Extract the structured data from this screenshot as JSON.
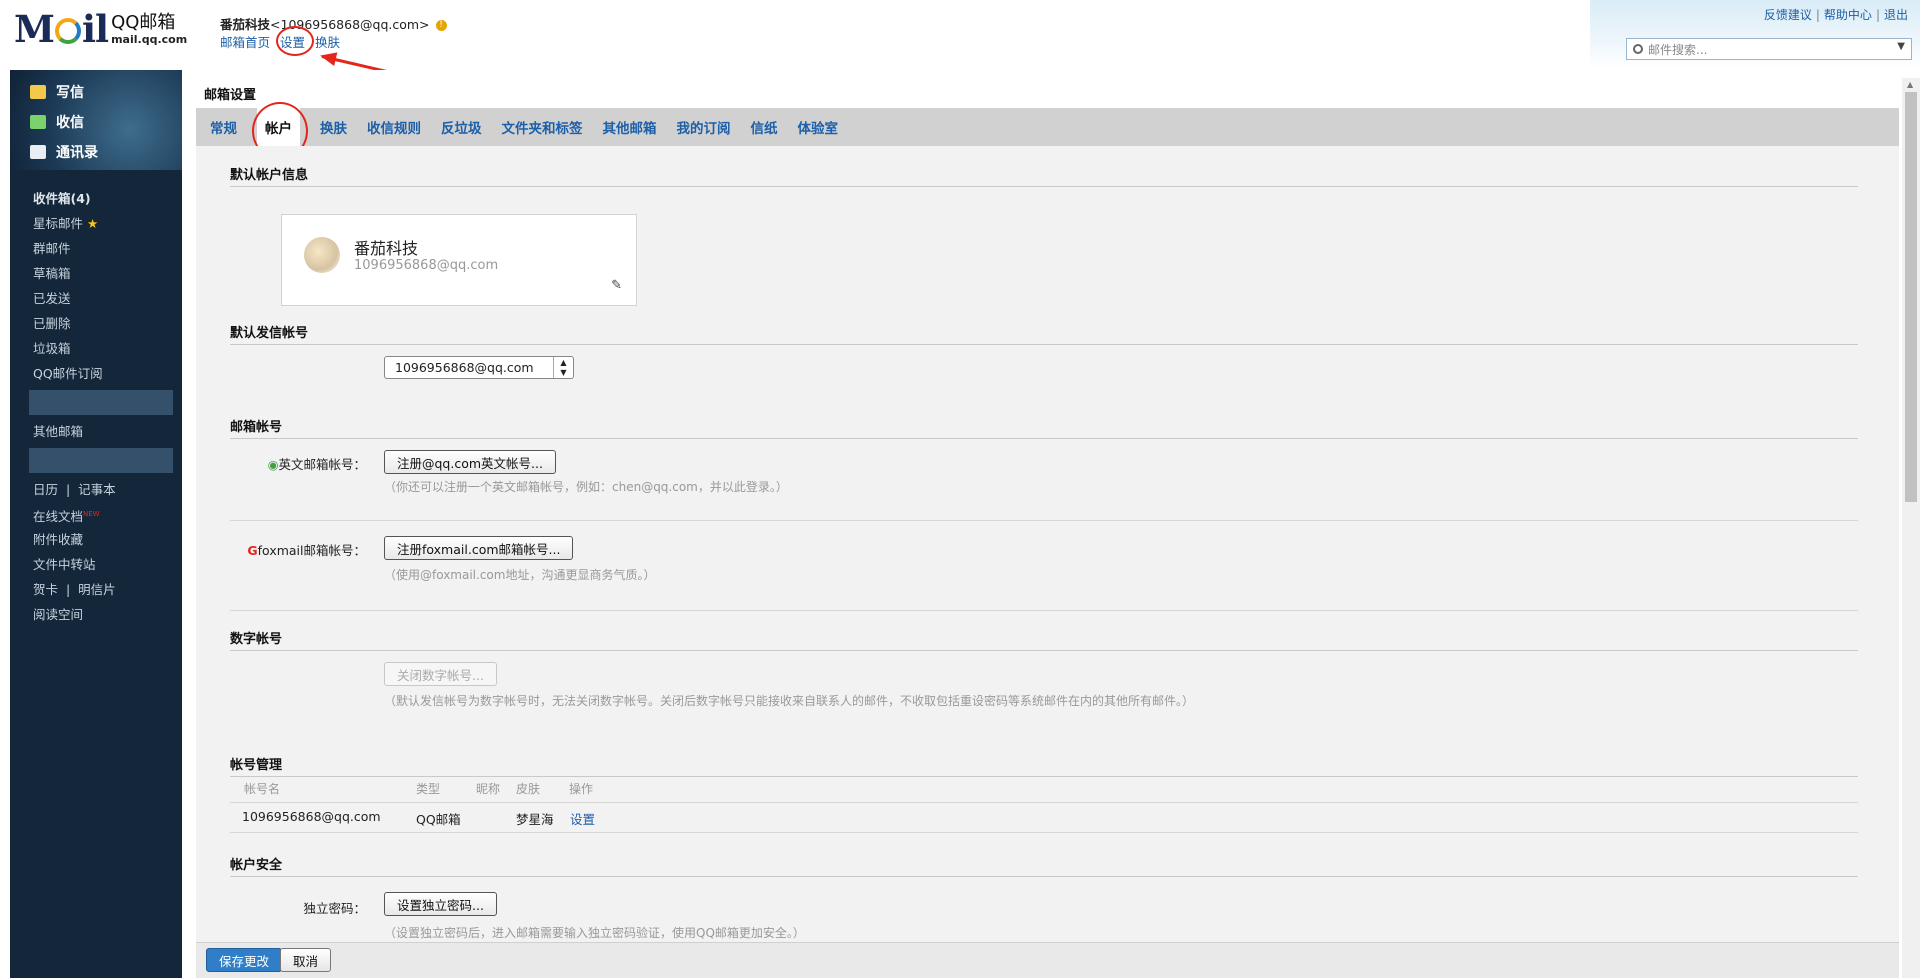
{
  "header": {
    "logo_mark": "MOIL",
    "logo_title": "QQ邮箱",
    "logo_domain": "mail.qq.com",
    "user_name": "番茄科技",
    "user_email": "<1096956868@qq.com>",
    "top_links": [
      "邮箱首页",
      "设置",
      "换肤"
    ],
    "right_links": [
      "反馈建议",
      "帮助中心",
      "退出"
    ],
    "search_placeholder": "邮件搜索..."
  },
  "sidebar": {
    "nav": [
      {
        "label": "写信",
        "icon": "compose-icon"
      },
      {
        "label": "收信",
        "icon": "inbox-download-icon"
      },
      {
        "label": "通讯录",
        "icon": "contacts-icon"
      }
    ],
    "folders": [
      "收件箱(4)",
      "星标邮件",
      "群邮件",
      "草稿箱",
      "已发送",
      "已删除",
      "垃圾箱",
      "QQ邮件订阅"
    ],
    "other": "其他邮箱",
    "tools": [
      "日历",
      "记事本",
      "在线文档",
      "NEW",
      "附件收藏",
      "文件中转站",
      "贺卡",
      "明信片",
      "阅读空间"
    ]
  },
  "page_title": "邮箱设置",
  "tabs": [
    "常规",
    "帐户",
    "换肤",
    "收信规则",
    "反垃圾",
    "文件夹和标签",
    "其他邮箱",
    "我的订阅",
    "信纸",
    "体验室"
  ],
  "active_tab": "帐户",
  "default_account": {
    "section": "默认帐户信息",
    "name": "番茄科技",
    "email": "1096956868@qq.com"
  },
  "default_sender": {
    "section": "默认发信帐号",
    "value": "1096956868@qq.com"
  },
  "mail_accounts": {
    "section": "邮箱帐号",
    "english_label": "英文邮箱帐号：",
    "english_button": "注册@qq.com英文帐号...",
    "english_hint": "（你还可以注册一个英文邮箱帐号，例如：chen@qq.com，并以此登录。）",
    "foxmail_label": "foxmail邮箱帐号：",
    "foxmail_button": "注册foxmail.com邮箱帐号...",
    "foxmail_hint": "（使用@foxmail.com地址，沟通更显商务气质。）"
  },
  "digital_account": {
    "section": "数字帐号",
    "button": "关闭数字帐号...",
    "hint": "（默认发信帐号为数字帐号时，无法关闭数字帐号。关闭后数字帐号只能接收来自联系人的邮件，不收取包括重设密码等系统邮件在内的其他所有邮件。）"
  },
  "account_management": {
    "section": "帐号管理",
    "columns": [
      "帐号名",
      "类型",
      "昵称",
      "皮肤",
      "操作"
    ],
    "rows": [
      {
        "name": "1096956868@qq.com",
        "type": "QQ邮箱",
        "nickname": "",
        "skin": "梦星海",
        "action": "设置"
      }
    ]
  },
  "account_security": {
    "section": "帐户安全",
    "password_label": "独立密码：",
    "password_button": "设置独立密码...",
    "password_hint": "（设置独立密码后，进入邮箱需要输入独立密码验证，使用QQ邮箱更加安全。）"
  },
  "footer": {
    "save": "保存更改",
    "cancel": "取消"
  },
  "colors": {
    "link": "#1d5fa8",
    "sidebar_bg": "#14263a",
    "tab_bar": "#d1d1d1",
    "content_bg": "#f2f2f2",
    "primary_button": "#2f7ec7",
    "annotation": "#e4261a"
  }
}
